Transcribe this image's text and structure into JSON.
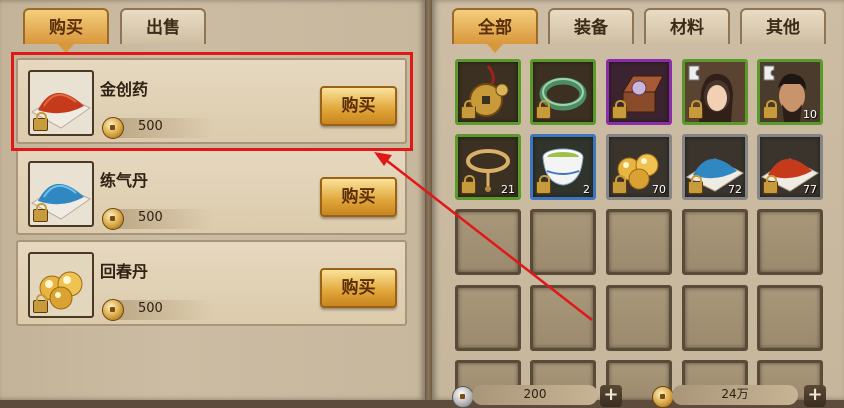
{
  "left_tabs": [
    {
      "label": "购买",
      "active": true
    },
    {
      "label": "出售",
      "active": false
    }
  ],
  "right_tabs": [
    {
      "label": "全部",
      "active": true
    },
    {
      "label": "装备",
      "active": false
    },
    {
      "label": "材料",
      "active": false
    },
    {
      "label": "其他",
      "active": false
    }
  ],
  "shop_items": [
    {
      "name": "金创药",
      "price": "500",
      "buy_label": "购买",
      "icon": "red-powder-icon",
      "highlighted": true
    },
    {
      "name": "练气丹",
      "price": "500",
      "buy_label": "购买",
      "icon": "blue-powder-icon",
      "highlighted": false
    },
    {
      "name": "回春丹",
      "price": "500",
      "buy_label": "购买",
      "icon": "gold-pills-icon",
      "highlighted": false
    }
  ],
  "inventory": [
    {
      "icon": "jade-pendant-icon",
      "rarity": "green",
      "count": ""
    },
    {
      "icon": "jade-bracelet-icon",
      "rarity": "green",
      "count": ""
    },
    {
      "icon": "treasure-chest-icon",
      "rarity": "purple",
      "count": ""
    },
    {
      "icon": "heroine-puzzle-icon",
      "rarity": "green",
      "count": ""
    },
    {
      "icon": "warrior-puzzle-icon",
      "rarity": "green",
      "count": "10"
    },
    {
      "icon": "rope-necklace-icon",
      "rarity": "green",
      "count": "21"
    },
    {
      "icon": "tea-cup-icon",
      "rarity": "blue",
      "count": "2"
    },
    {
      "icon": "gold-pills-icon",
      "rarity": "gray",
      "count": "70"
    },
    {
      "icon": "blue-powder-icon",
      "rarity": "gray",
      "count": "72"
    },
    {
      "icon": "red-powder-icon",
      "rarity": "gray",
      "count": "77"
    }
  ],
  "currency": {
    "silver": "200",
    "gold": "24万"
  },
  "colors": {
    "highlight": "#e01818",
    "tab_active": "#d9973c",
    "button": "#e0a538"
  }
}
